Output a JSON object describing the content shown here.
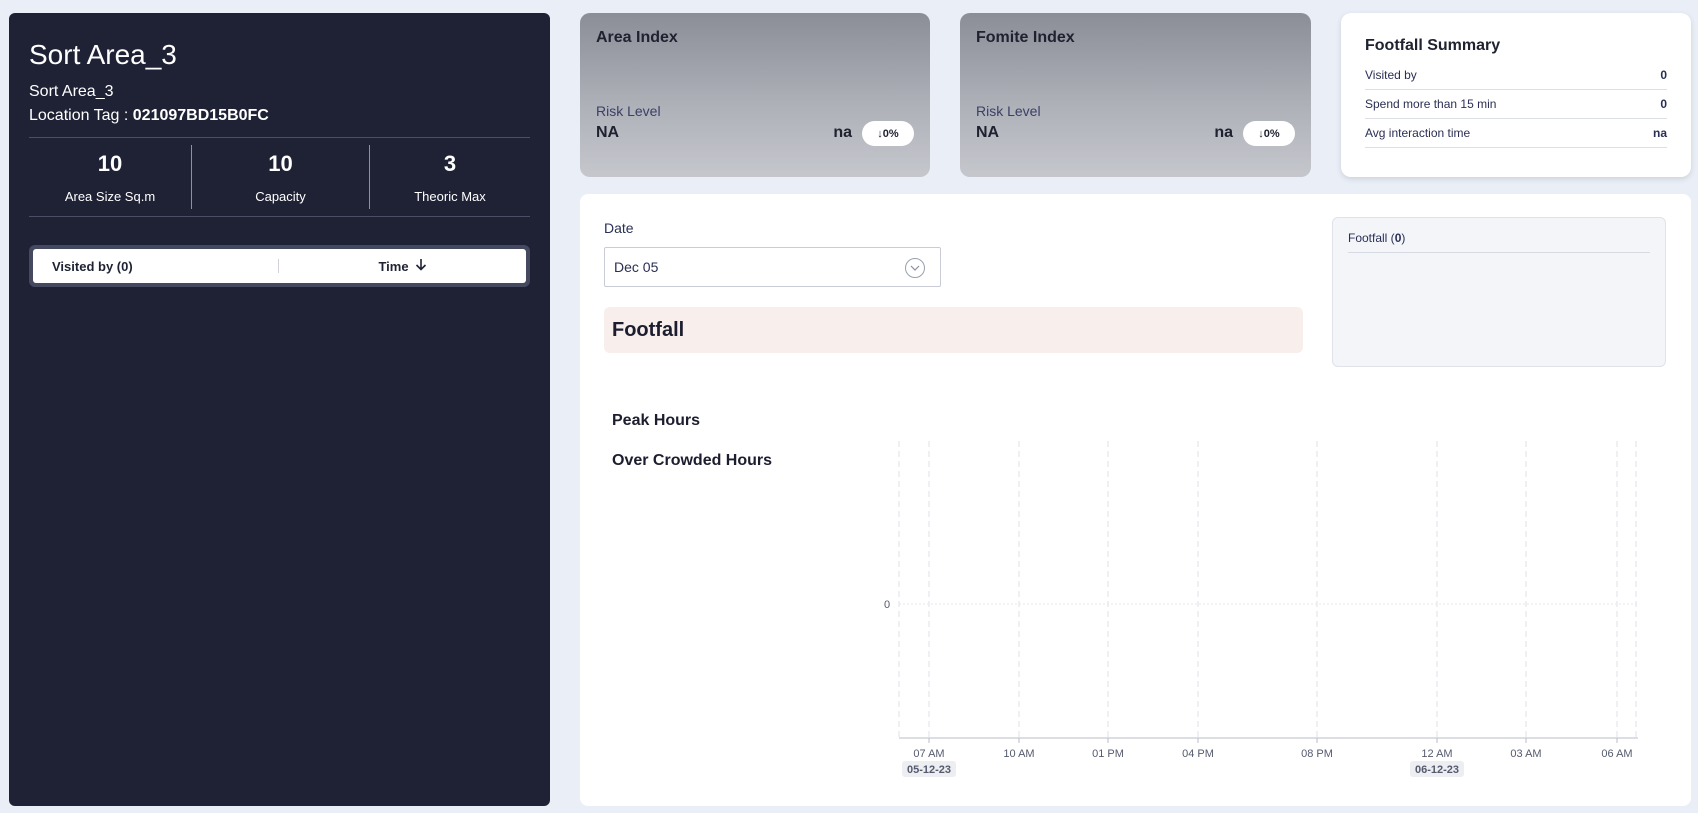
{
  "area": {
    "title": "Sort Area_3",
    "subtitle": "Sort Area_3",
    "location_label": "Location Tag : ",
    "location_value": "021097BD15B0FC",
    "stats": [
      {
        "value": "10",
        "label": "Area Size Sq.m"
      },
      {
        "value": "10",
        "label": "Capacity"
      },
      {
        "value": "3",
        "label": "Theoric Max"
      }
    ],
    "table": {
      "col_visited": "Visited by (0)",
      "col_time": "Time"
    }
  },
  "area_index": {
    "title": "Area Index",
    "risk_label": "Risk Level",
    "risk_value": "NA",
    "na": "na",
    "change": "0%"
  },
  "fomite_index": {
    "title": "Fomite Index",
    "risk_label": "Risk Level",
    "risk_value": "NA",
    "na": "na",
    "change": "0%"
  },
  "summary": {
    "title": "Footfall Summary",
    "rows": [
      {
        "label": "Visited by",
        "value": "0"
      },
      {
        "label": "Spend more than 15 min",
        "value": "0"
      },
      {
        "label": "Avg interaction time",
        "value": "na"
      }
    ]
  },
  "main": {
    "date_label": "Date",
    "date_value": "Dec 05",
    "footfall_heading": "Footfall",
    "footfall_box_label": "Footfall (",
    "footfall_box_count": "0",
    "footfall_box_close": ")",
    "peak_hours": "Peak Hours",
    "over_crowded": "Over Crowded Hours"
  },
  "colors": {
    "dark_panel": "#1f2235",
    "accent_bar": "#f8eeec"
  },
  "chart_data": {
    "type": "line",
    "ylabel": "Footfall",
    "y_ticks": [
      "0"
    ],
    "x_ticks": [
      "07 AM",
      "10 AM",
      "01 PM",
      "04 PM",
      "08 PM",
      "12 AM",
      "03 AM",
      "06 AM"
    ],
    "date_labels": [
      "05-12-23",
      "06-12-23"
    ],
    "series": []
  }
}
